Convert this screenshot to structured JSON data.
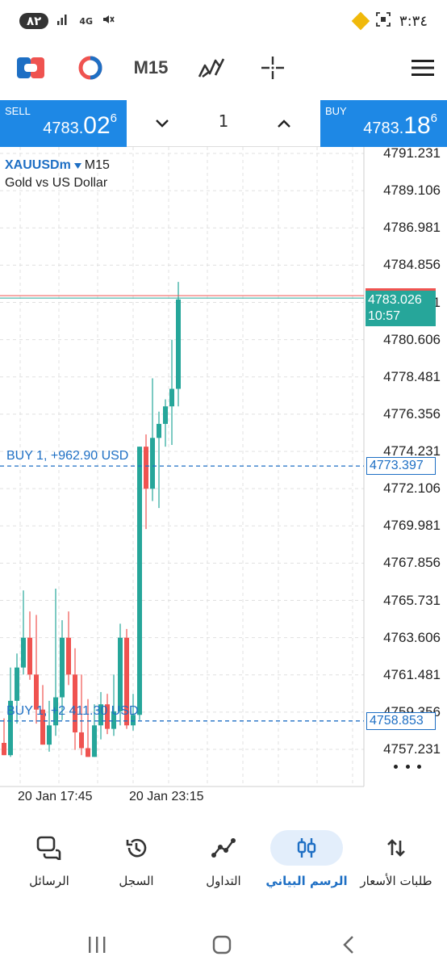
{
  "status_bar": {
    "battery": "٨٢",
    "network": "4G",
    "time": "٣:٣٤"
  },
  "toolbar": {
    "timeframe": "M15",
    "icons": [
      "one-click-trading-icon",
      "indicators-icon",
      "timeframe-selector",
      "objects-icon",
      "crosshair-icon",
      "menu-icon"
    ]
  },
  "trade_panel": {
    "sell": {
      "label": "SELL",
      "price_main": "4783.",
      "price_big": "02",
      "price_sup": "6"
    },
    "buy": {
      "label": "BUY",
      "price_main": "4783.",
      "price_big": "18",
      "price_sup": "6"
    },
    "quantity": "1"
  },
  "chart": {
    "symbol": "XAUUSDm",
    "timeframe": "M15",
    "description": "Gold vs US Dollar",
    "colors": {
      "bull": "#26a69a",
      "bear": "#ef5350",
      "position": "#1e6fc4",
      "grid": "#e0e0e0"
    },
    "current_price": "4783.026",
    "countdown": "10:57",
    "positions": [
      {
        "label": "BUY 1,  +962.90 USD",
        "price": "4773.397"
      },
      {
        "label": "BUY 1,  +2 411.30 USD",
        "price": "4758.853"
      }
    ],
    "time_labels": [
      "20 Jan 17:45",
      "20 Jan 23:15"
    ]
  },
  "chart_data": {
    "type": "candlestick",
    "y_tick_labels": [
      "4791.231",
      "4789.106",
      "4786.981",
      "4784.856",
      "4782.731",
      "4780.606",
      "4778.481",
      "4776.356",
      "4774.231",
      "4772.106",
      "4769.981",
      "4767.856",
      "4765.731",
      "4763.606",
      "4761.481",
      "4759.356",
      "4757.231"
    ],
    "ylim": [
      4756.8,
      4791.5
    ],
    "x": [
      "20 Jan 17:45",
      "20 Jan 23:15"
    ],
    "candles": [
      {
        "o": 4757.6,
        "h": 4759.0,
        "l": 4756.9,
        "c": 4756.9
      },
      {
        "o": 4756.9,
        "h": 4761.9,
        "l": 4756.8,
        "c": 4760.0
      },
      {
        "o": 4760.0,
        "h": 4762.7,
        "l": 4758.7,
        "c": 4761.9
      },
      {
        "o": 4761.9,
        "h": 4766.3,
        "l": 4761.5,
        "c": 4763.6
      },
      {
        "o": 4763.6,
        "h": 4765.1,
        "l": 4761.2,
        "c": 4761.5
      },
      {
        "o": 4761.5,
        "h": 4764.9,
        "l": 4758.7,
        "c": 4759.5
      },
      {
        "o": 4759.5,
        "h": 4760.9,
        "l": 4757.5,
        "c": 4757.5
      },
      {
        "o": 4757.5,
        "h": 4760.0,
        "l": 4757.1,
        "c": 4758.6
      },
      {
        "o": 4758.6,
        "h": 4766.4,
        "l": 4758.0,
        "c": 4760.2
      },
      {
        "o": 4760.2,
        "h": 4764.6,
        "l": 4758.9,
        "c": 4763.6
      },
      {
        "o": 4763.6,
        "h": 4765.1,
        "l": 4760.9,
        "c": 4761.5
      },
      {
        "o": 4761.5,
        "h": 4763.0,
        "l": 4757.2,
        "c": 4758.2
      },
      {
        "o": 4758.2,
        "h": 4761.5,
        "l": 4756.9,
        "c": 4757.3
      },
      {
        "o": 4757.3,
        "h": 4760.1,
        "l": 4756.8,
        "c": 4756.8
      },
      {
        "o": 4756.8,
        "h": 4759.8,
        "l": 4756.8,
        "c": 4758.6
      },
      {
        "o": 4758.6,
        "h": 4760.5,
        "l": 4757.8,
        "c": 4759.8
      },
      {
        "o": 4759.8,
        "h": 4760.4,
        "l": 4758.1,
        "c": 4758.4
      },
      {
        "o": 4758.4,
        "h": 4761.5,
        "l": 4758.0,
        "c": 4759.4
      },
      {
        "o": 4759.4,
        "h": 4764.4,
        "l": 4758.6,
        "c": 4763.6
      },
      {
        "o": 4763.6,
        "h": 4764.1,
        "l": 4758.4,
        "c": 4758.6
      },
      {
        "o": 4758.6,
        "h": 4760.4,
        "l": 4758.3,
        "c": 4759.2
      },
      {
        "o": 4759.2,
        "h": 4774.5,
        "l": 4758.9,
        "c": 4774.5
      },
      {
        "o": 4774.5,
        "h": 4775.2,
        "l": 4769.8,
        "c": 4772.1
      },
      {
        "o": 4772.1,
        "h": 4778.4,
        "l": 4771.4,
        "c": 4775.0
      },
      {
        "o": 4775.0,
        "h": 4776.5,
        "l": 4771.0,
        "c": 4775.8
      },
      {
        "o": 4775.8,
        "h": 4777.2,
        "l": 4774.5,
        "c": 4776.8
      },
      {
        "o": 4776.8,
        "h": 4780.6,
        "l": 4774.6,
        "c": 4777.8
      },
      {
        "o": 4777.8,
        "h": 4783.9,
        "l": 4776.8,
        "c": 4782.9
      }
    ],
    "current_price": 4783.026,
    "position_prices": [
      4773.397,
      4758.853
    ]
  },
  "bottom_nav": {
    "items": [
      {
        "label": "طلبات الأسعار",
        "icon": "quotes-arrows-icon",
        "active": false
      },
      {
        "label": "الرسم البياني",
        "icon": "chart-candles-icon",
        "active": true
      },
      {
        "label": "التداول",
        "icon": "trade-line-icon",
        "active": false
      },
      {
        "label": "السجل",
        "icon": "history-icon",
        "active": false
      },
      {
        "label": "الرسائل",
        "icon": "messages-icon",
        "active": false
      }
    ]
  }
}
